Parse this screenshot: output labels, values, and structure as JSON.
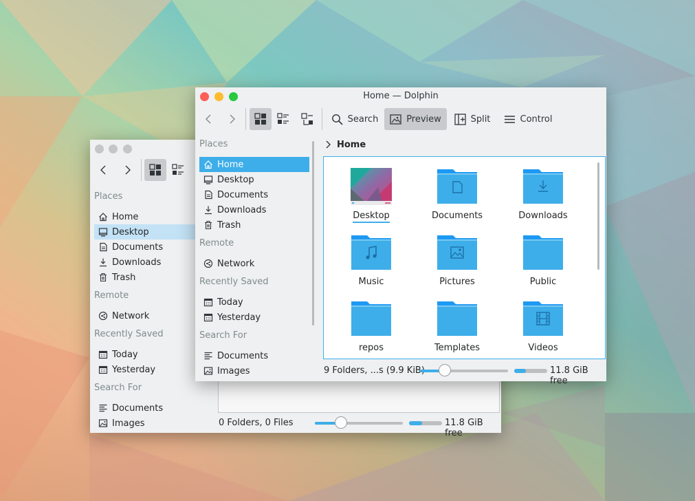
{
  "colors": {
    "accent": "#3daee9",
    "window_bg": "#eff0f1",
    "close": "#fe5f57",
    "minimize": "#febc2e",
    "maximize": "#28c840",
    "inactive_button": "#c4c6c8"
  },
  "back_window": {
    "places": {
      "sections": [
        {
          "title": "Places",
          "items": [
            {
              "label": "Home",
              "icon": "home-icon"
            },
            {
              "label": "Desktop",
              "icon": "desktop-icon",
              "selected": true
            },
            {
              "label": "Documents",
              "icon": "documents-icon"
            },
            {
              "label": "Downloads",
              "icon": "downloads-icon"
            },
            {
              "label": "Trash",
              "icon": "trash-icon"
            }
          ]
        },
        {
          "title": "Remote",
          "items": [
            {
              "label": "Network",
              "icon": "network-icon"
            }
          ]
        },
        {
          "title": "Recently Saved",
          "items": [
            {
              "label": "Today",
              "icon": "calendar-icon"
            },
            {
              "label": "Yesterday",
              "icon": "calendar-icon"
            }
          ]
        },
        {
          "title": "Search For",
          "items": [
            {
              "label": "Documents",
              "icon": "text-lines-icon"
            },
            {
              "label": "Images",
              "icon": "image-icon"
            }
          ]
        }
      ]
    },
    "status": {
      "text": "0 Folders, 0 Files",
      "zoom_fraction": 0.3,
      "free_text": "11.8 GiB free",
      "used_fraction": 0.4
    }
  },
  "main_window": {
    "title": "Home — Dolphin",
    "toolbar": {
      "search_label": "Search",
      "preview_label": "Preview",
      "split_label": "Split",
      "control_label": "Control"
    },
    "breadcrumb": {
      "current": "Home"
    },
    "places": {
      "sections": [
        {
          "title": "Places",
          "items": [
            {
              "label": "Home",
              "icon": "home-icon",
              "selected": true
            },
            {
              "label": "Desktop",
              "icon": "desktop-icon"
            },
            {
              "label": "Documents",
              "icon": "documents-icon"
            },
            {
              "label": "Downloads",
              "icon": "downloads-icon"
            },
            {
              "label": "Trash",
              "icon": "trash-icon"
            }
          ]
        },
        {
          "title": "Remote",
          "items": [
            {
              "label": "Network",
              "icon": "network-icon"
            }
          ]
        },
        {
          "title": "Recently Saved",
          "items": [
            {
              "label": "Today",
              "icon": "calendar-icon"
            },
            {
              "label": "Yesterday",
              "icon": "calendar-icon"
            }
          ]
        },
        {
          "title": "Search For",
          "items": [
            {
              "label": "Documents",
              "icon": "text-lines-icon"
            },
            {
              "label": "Images",
              "icon": "image-icon"
            }
          ]
        }
      ]
    },
    "files": [
      {
        "name": "Desktop",
        "icon": "desktop-thumbnail",
        "current": true
      },
      {
        "name": "Documents",
        "icon": "folder-documents-icon"
      },
      {
        "name": "Downloads",
        "icon": "folder-downloads-icon"
      },
      {
        "name": "Music",
        "icon": "folder-music-icon"
      },
      {
        "name": "Pictures",
        "icon": "folder-pictures-icon"
      },
      {
        "name": "Public",
        "icon": "folder-icon"
      },
      {
        "name": "repos",
        "icon": "folder-icon"
      },
      {
        "name": "Templates",
        "icon": "folder-icon"
      },
      {
        "name": "Videos",
        "icon": "folder-videos-icon"
      }
    ],
    "status": {
      "text": "9 Folders, ...s (9.9 KiB)",
      "zoom_fraction": 0.28,
      "free_text": "11.8 GiB free",
      "used_fraction": 0.35
    }
  }
}
